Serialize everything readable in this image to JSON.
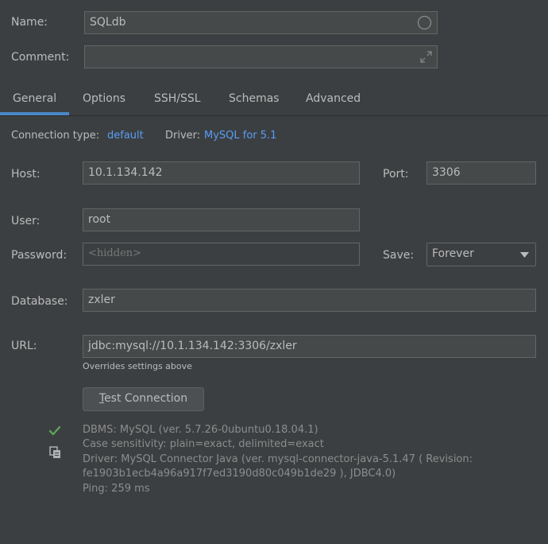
{
  "form": {
    "name_label": "Name:",
    "name_value": "SQLdb",
    "comment_label": "Comment:",
    "comment_value": ""
  },
  "tabs": [
    {
      "label": "General",
      "active": true
    },
    {
      "label": "Options",
      "active": false
    },
    {
      "label": "SSH/SSL",
      "active": false
    },
    {
      "label": "Schemas",
      "active": false
    },
    {
      "label": "Advanced",
      "active": false
    }
  ],
  "general": {
    "connection_type_label": "Connection type:",
    "connection_type_value": "default",
    "driver_label": "Driver:",
    "driver_value": "MySQL for 5.1",
    "host_label": "Host:",
    "host_value": "10.1.134.142",
    "port_label": "Port:",
    "port_value": "3306",
    "user_label": "User:",
    "user_value": "root",
    "password_label": "Password:",
    "password_placeholder": "<hidden>",
    "save_label": "Save:",
    "save_value": "Forever",
    "database_label": "Database:",
    "database_value": "zxler",
    "url_label": "URL:",
    "url_value": "jdbc:mysql://10.1.134.142:3306/zxler",
    "url_hint": "Overrides settings above",
    "test_button_mnemonic": "T",
    "test_button_rest": "est Connection"
  },
  "result": {
    "lines": [
      "DBMS: MySQL (ver. 5.7.26-0ubuntu0.18.04.1)",
      "Case sensitivity: plain=exact, delimited=exact",
      "Driver: MySQL Connector Java (ver. mysql-connector-java-5.1.47 ( Revision:",
      "fe1903b1ecb4a96a917f7ed3190d80c049b1de29 ), JDBC4.0)",
      "Ping: 259 ms"
    ]
  },
  "colors": {
    "background": "#3c3f41",
    "link": "#589df6",
    "tab_underline": "#4a88c7",
    "success_check": "#5ea25a"
  }
}
